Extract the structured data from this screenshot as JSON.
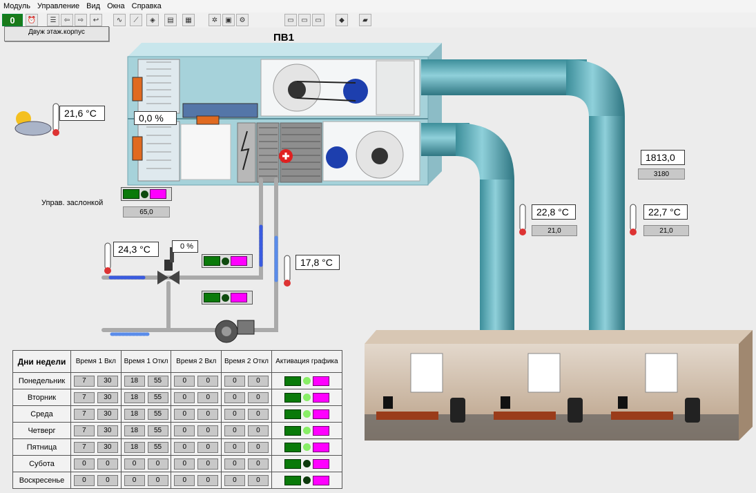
{
  "menu": [
    "Модуль",
    "Управление",
    "Вид",
    "Окна",
    "Справка"
  ],
  "toolbar": {
    "counter": "0",
    "icons": [
      "alarm-clock-icon",
      "list-icon",
      "arrow-left-icon",
      "arrow-right-icon",
      "arrow-back-icon",
      "chart-icon",
      "graph-icon",
      "layers-icon",
      "document-icon",
      "log-icon",
      "tools-icon",
      "monitor-icon",
      "settings-icon",
      "window-1-icon",
      "window-2-icon",
      "window-3-icon",
      "eraser-icon",
      "book-icon"
    ]
  },
  "building_button": "Двуж этаж.корпус",
  "unit_title": "ПВ1",
  "outdoor_temp": "21,6 °С",
  "damper_position": "0,0 %",
  "damper_label": "Управ. заслонкой",
  "damper_setpoint": "65,0",
  "water_supply_temp": "24,3 °С",
  "valve_position": "0 %",
  "water_return_temp": "17,8 °С",
  "supply_air_flow": "1813,0",
  "supply_air_flow_set": "3180",
  "supply_duct_temp": "22,8 °С",
  "supply_duct_set": "21,0",
  "exhaust_duct_temp": "22,7 °С",
  "exhaust_duct_set": "21,0",
  "schedule": {
    "headers": [
      "Дни недели",
      "Время 1 Вкл",
      "Время 1 Откл",
      "Время 2 Вкл",
      "Время 2 Откл",
      "Активация графика"
    ],
    "rows": [
      {
        "day": "Понедельник",
        "t1on": [
          "7",
          "30"
        ],
        "t1off": [
          "18",
          "55"
        ],
        "t2on": [
          "0",
          "0"
        ],
        "t2off": [
          "0",
          "0"
        ],
        "active": true
      },
      {
        "day": "Вторник",
        "t1on": [
          "7",
          "30"
        ],
        "t1off": [
          "18",
          "55"
        ],
        "t2on": [
          "0",
          "0"
        ],
        "t2off": [
          "0",
          "0"
        ],
        "active": true
      },
      {
        "day": "Среда",
        "t1on": [
          "7",
          "30"
        ],
        "t1off": [
          "18",
          "55"
        ],
        "t2on": [
          "0",
          "0"
        ],
        "t2off": [
          "0",
          "0"
        ],
        "active": true
      },
      {
        "day": "Четверг",
        "t1on": [
          "7",
          "30"
        ],
        "t1off": [
          "18",
          "55"
        ],
        "t2on": [
          "0",
          "0"
        ],
        "t2off": [
          "0",
          "0"
        ],
        "active": true
      },
      {
        "day": "Пятница",
        "t1on": [
          "7",
          "30"
        ],
        "t1off": [
          "18",
          "55"
        ],
        "t2on": [
          "0",
          "0"
        ],
        "t2off": [
          "0",
          "0"
        ],
        "active": true
      },
      {
        "day": "Субота",
        "t1on": [
          "0",
          "0"
        ],
        "t1off": [
          "0",
          "0"
        ],
        "t2on": [
          "0",
          "0"
        ],
        "t2off": [
          "0",
          "0"
        ],
        "active": false
      },
      {
        "day": "Воскресенье",
        "t1on": [
          "0",
          "0"
        ],
        "t1off": [
          "0",
          "0"
        ],
        "t2on": [
          "0",
          "0"
        ],
        "t2off": [
          "0",
          "0"
        ],
        "active": false
      }
    ]
  },
  "colors": {
    "duct": "#4fa3b0",
    "unit": "#a8d4dc",
    "green": "#0a7a0a",
    "magenta": "#ff00ff",
    "water_hot": "#3a5be0"
  }
}
